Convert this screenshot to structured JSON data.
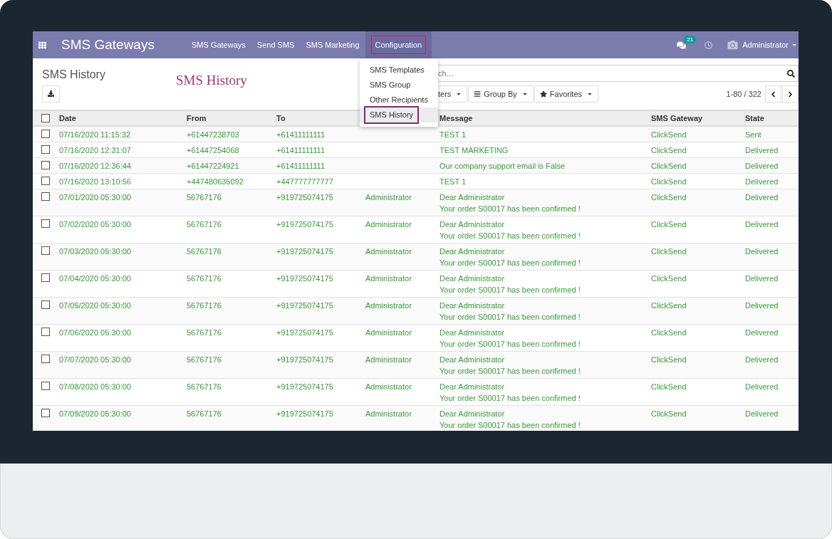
{
  "app_title": "SMS Gateways",
  "menu": [
    {
      "label": "SMS Gateways",
      "selected": false
    },
    {
      "label": "Send SMS",
      "selected": false
    },
    {
      "label": "SMS Marketing",
      "selected": false
    },
    {
      "label": "Configuration",
      "selected": true
    }
  ],
  "messages_badge": "21",
  "user": "Administrator",
  "dropdown": [
    {
      "label": "SMS Templates",
      "selected": false
    },
    {
      "label": "SMS Group",
      "selected": false
    },
    {
      "label": "Other Recipients",
      "selected": false
    },
    {
      "label": "SMS History",
      "selected": true
    }
  ],
  "breadcrumb": "SMS History",
  "annotation": "SMS History",
  "search": {
    "placeholder": "ch..."
  },
  "filter_buttons": [
    {
      "label": "ters",
      "kind": "filter"
    },
    {
      "label": "Group By",
      "kind": "group"
    },
    {
      "label": "Favorites",
      "kind": "star"
    }
  ],
  "pager": "1-80 / 322",
  "select_all_checked": false,
  "columns": [
    "Date",
    "From",
    "To",
    "Message",
    "SMS Gateway",
    "State"
  ],
  "rows": [
    {
      "date": "07/16/2020 11:15:32",
      "from": "+61447238703",
      "to": "+61411111111",
      "message": [
        "TEST 1"
      ],
      "gateway": "ClickSend",
      "state": "Sent",
      "checked": false
    },
    {
      "date": "07/16/2020 12:31:07",
      "from": "+61447254068",
      "to": "+61411111111",
      "message": [
        "TEST MARKETING"
      ],
      "gateway": "ClickSend",
      "state": "Delivered",
      "checked": false
    },
    {
      "date": "07/16/2020 12:36:44",
      "from": "+61447224921",
      "to": "+61411111111",
      "message": [
        "Our company support email is False"
      ],
      "gateway": "ClickSend",
      "state": "Delivered",
      "checked": false
    },
    {
      "date": "07/16/2020 13:10:56",
      "from": "+447480635092",
      "to": "+447777777777",
      "message": [
        "TEST 1"
      ],
      "gateway": "ClickSend",
      "state": "Delivered",
      "checked": false
    },
    {
      "date": "07/01/2020 05:30:00",
      "from": "56767176",
      "to": "+919725074175",
      "partner": "Administrator",
      "message": [
        "Dear Administrator",
        "Your order S00017 has been confirmed !"
      ],
      "gateway": "ClickSend",
      "state": "Delivered",
      "checked": false
    },
    {
      "date": "07/02/2020 05:30:00",
      "from": "56767176",
      "to": "+919725074175",
      "partner": "Administrator",
      "message": [
        "Dear Administrator",
        "Your order S00017 has been confirmed !"
      ],
      "gateway": "ClickSend",
      "state": "Delivered",
      "checked": false
    },
    {
      "date": "07/03/2020 05:30:00",
      "from": "56767176",
      "to": "+919725074175",
      "partner": "Administrator",
      "message": [
        "Dear Administrator",
        "Your order S00017 has been confirmed !"
      ],
      "gateway": "ClickSend",
      "state": "Delivered",
      "checked": false
    },
    {
      "date": "07/04/2020 05:30:00",
      "from": "56767176",
      "to": "+919725074175",
      "partner": "Administrator",
      "message": [
        "Dear Administrator",
        "Your order S00017 has been confirmed !"
      ],
      "gateway": "ClickSend",
      "state": "Delivered",
      "checked": false
    },
    {
      "date": "07/05/2020 05:30:00",
      "from": "56767176",
      "to": "+919725074175",
      "partner": "Administrator",
      "message": [
        "Dear Administrator",
        "Your order S00017 has been confirmed !"
      ],
      "gateway": "ClickSend",
      "state": "Delivered",
      "checked": false
    },
    {
      "date": "07/06/2020 05:30:00",
      "from": "56767176",
      "to": "+919725074175",
      "partner": "Administrator",
      "message": [
        "Dear Administrator",
        "Your order S00017 has been confirmed !"
      ],
      "gateway": "ClickSend",
      "state": "Delivered",
      "checked": false
    },
    {
      "date": "07/07/2020 05:30:00",
      "from": "56767176",
      "to": "+919725074175",
      "partner": "Administrator",
      "message": [
        "Dear Administrator",
        "Your order S00017 has been confirmed !"
      ],
      "gateway": "ClickSend",
      "state": "Delivered",
      "checked": false
    },
    {
      "date": "07/08/2020 05:30:00",
      "from": "56767176",
      "to": "+919725074175",
      "partner": "Administrator",
      "message": [
        "Dear Administrator",
        "Your order S00017 has been confirmed !"
      ],
      "gateway": "ClickSend",
      "state": "Delivered",
      "checked": false
    },
    {
      "date": "07/09/2020 05:30:00",
      "from": "56767176",
      "to": "+919725074175",
      "partner": "Administrator",
      "message": [
        "Dear Administrator",
        "Your order S00017 has been confirmed !"
      ],
      "gateway": "ClickSend",
      "state": "Delivered",
      "checked": false
    }
  ]
}
